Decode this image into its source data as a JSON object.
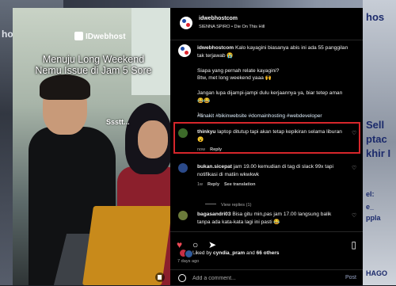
{
  "video": {
    "brand": "IDwebhost",
    "caption_line1": "Menuju Long Weekend",
    "caption_line2": "Nemu Issue di Jam 5 Sore",
    "overlay_text": "Ssstt..."
  },
  "background": {
    "right_words": [
      "hos",
      "Sell",
      "ptac",
      "khir I",
      "el:",
      "e_",
      "ppla",
      "HAGO"
    ],
    "left_words": [
      "host"
    ]
  },
  "header": {
    "username": "idwebhostcom",
    "audio": "SIENNA SPIRO • Die On This Hill",
    "more_icon": "more-horizontal-icon"
  },
  "caption": {
    "username": "idwebhostcom",
    "lines": [
      "Kalo kayagini biasanya abis ini ada 55 panggilan",
      "tak terjawab 😭",
      "",
      "Siapa yang pernah relate kayagini?",
      "Btw, met long weekend yaaa 🙌",
      "",
      "Jangan lupa dijampi-jampi dulu kerjaannya ya, biar tetep aman",
      "😂😂"
    ],
    "hashtags": "#anakit #bikinwebsite #domainhosting #webdeveloper",
    "time": "1w"
  },
  "comments": [
    {
      "username": "thinkyu",
      "text": "laptop ditutup tapi akan tetap kepikiran selama liburan",
      "text2": "😮",
      "time": "now",
      "reply": "Reply",
      "highlighted": true
    },
    {
      "username": "bukan.sicepat",
      "text": "jam 19.00 kemudian di tag di slack 99x tapi",
      "text2": "notifikasi di matiin wkwkwk",
      "time": "1w",
      "reply": "Reply",
      "translation": "See translation",
      "replies": "View replies (1)"
    },
    {
      "username": "bagasandri03",
      "text": "Bisa gitu min,pas jam 17.00 langsung balik",
      "text2": "tanpa ada kata-kata lagi ini pasti 😂",
      "time": "",
      "reply": ""
    }
  ],
  "actions": {
    "like": "heart-filled-icon",
    "comment": "comment-icon",
    "share": "share-icon",
    "save": "bookmark-icon",
    "like_color": "#ed4956"
  },
  "likes": {
    "prefix": "Liked by",
    "user": "cyndia_pram",
    "middle": "and",
    "count": "66 others"
  },
  "posted": "7 days ago",
  "add_comment": {
    "placeholder": "Add a comment...",
    "post": "Post"
  },
  "colors": {
    "highlight": "#d6262b",
    "brand_blue": "#1f4aa8",
    "brand_red": "#e0242e"
  }
}
